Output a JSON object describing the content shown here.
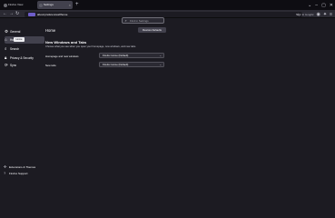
{
  "tabs": [
    {
      "title": "Firefox View"
    },
    {
      "title": "Settings"
    }
  ],
  "window": {
    "minimize_icon": "minimize-icon",
    "maximize_icon": "maximize-icon",
    "close_icon": "close-icon"
  },
  "navbar": {
    "url": "about:preferences#home",
    "sync_label": "Sign in to sync"
  },
  "search": {
    "placeholder": "Find in Settings"
  },
  "sidebar": {
    "items": [
      {
        "label": "General",
        "icon": "gear-icon"
      },
      {
        "label": "Home",
        "icon": "home-icon"
      },
      {
        "label": "Search",
        "icon": "search-icon"
      },
      {
        "label": "Privacy & Security",
        "icon": "lock-icon"
      },
      {
        "label": "Sync",
        "icon": "sync-icon"
      }
    ],
    "tooltip": "Home",
    "footer": [
      {
        "label": "Extensions & Themes",
        "icon": "puzzle-icon"
      },
      {
        "label": "Firefox Support",
        "icon": "help-icon"
      }
    ]
  },
  "main": {
    "title": "Home",
    "restore_button": "Restore Defaults",
    "section_title": "New Windows and Tabs",
    "section_desc": "Choose what you see when you open your homepage, new windows, and new tabs.",
    "rows": [
      {
        "label": "Homepage and new windows",
        "value": "Firefox Home (Default)"
      },
      {
        "label": "New tabs",
        "value": "Firefox Home (Default)"
      }
    ]
  },
  "colors": {
    "background": "#1c1b22",
    "accent": "#6e5dc9"
  }
}
